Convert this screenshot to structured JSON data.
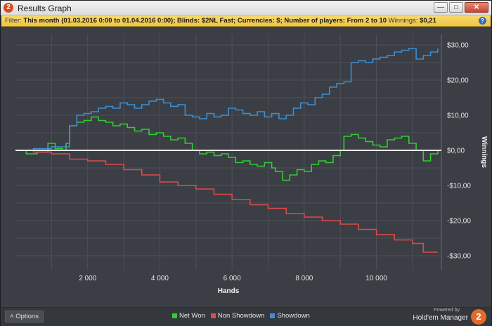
{
  "window": {
    "title": "Results Graph",
    "app_icon_glyph": "2",
    "minimize_glyph": "—",
    "maximize_glyph": "□",
    "close_glyph": "✕"
  },
  "filter": {
    "label": "Filter:",
    "text": "This month (01.03.2016 0:00 to 01.04.2016 0:00); Blinds: $2NL Fast; Currencies: $; Number of players: From 2 to 10",
    "winnings_label": "Winnings:",
    "winnings_value": "$0,21",
    "help_glyph": "?"
  },
  "footer": {
    "options_label": "Options",
    "options_glyph": "˄",
    "powered_by": "Powered by",
    "brand_name": "Hold'em Manager",
    "brand_logo_glyph": "2"
  },
  "colors": {
    "net_won": "#33cc33",
    "non_showdown": "#e04a4a",
    "showdown": "#3b8fd6",
    "zero_line": "#ffffff",
    "grid": "#4d5157",
    "filter_bg": "#f2c94c"
  },
  "chart_data": {
    "type": "line",
    "xlabel": "Hands",
    "ylabel": "Winnings",
    "xlim": [
      0,
      11800
    ],
    "ylim": [
      -34,
      33
    ],
    "x_ticks": [
      2000,
      4000,
      6000,
      8000,
      10000
    ],
    "x_tick_labels": [
      "2 000",
      "4 000",
      "6 000",
      "8 000",
      "10 000"
    ],
    "y_ticks": [
      30,
      20,
      10,
      0,
      -10,
      -20,
      -30
    ],
    "y_tick_labels": [
      "$30,00",
      "$20,00",
      "$10,00",
      "$0,00",
      "-$10,00",
      "-$20,00",
      "-$30,00"
    ],
    "grid": true,
    "legend_position": "bottom-center",
    "series": [
      {
        "name": "Net Won",
        "color": "#33cc33",
        "x": [
          0,
          300,
          600,
          900,
          1100,
          1300,
          1400,
          1500,
          1700,
          1900,
          2100,
          2300,
          2500,
          2700,
          2900,
          3100,
          3300,
          3500,
          3700,
          3900,
          4100,
          4300,
          4500,
          4700,
          4900,
          5100,
          5300,
          5500,
          5700,
          5900,
          6100,
          6300,
          6500,
          6700,
          6900,
          7100,
          7200,
          7400,
          7600,
          7800,
          8000,
          8200,
          8400,
          8600,
          8800,
          9000,
          9100,
          9300,
          9500,
          9700,
          9900,
          10100,
          10300,
          10500,
          10700,
          10900,
          11100,
          11300,
          11500,
          11700
        ],
        "y": [
          0,
          -1,
          -0.5,
          2,
          0.5,
          0,
          2,
          7,
          8,
          8.5,
          9.5,
          8.5,
          8,
          7,
          7.5,
          6.5,
          5.5,
          6,
          4.5,
          5,
          4,
          3,
          3.5,
          2,
          0,
          -1,
          -0.5,
          -1.5,
          -1,
          -2,
          -3.5,
          -3,
          -4,
          -4.5,
          -3.5,
          -5,
          -6,
          -8.5,
          -7,
          -5.5,
          -6,
          -4,
          -3,
          -3.5,
          -1.5,
          0,
          4,
          4.5,
          3.5,
          2.5,
          1.5,
          1,
          3,
          3.5,
          4,
          2,
          0,
          -3,
          -1,
          0
        ]
      },
      {
        "name": "Non Showdown",
        "color": "#e04a4a",
        "x": [
          0,
          500,
          1000,
          1500,
          2000,
          2500,
          3000,
          3500,
          4000,
          4500,
          5000,
          5500,
          6000,
          6500,
          7000,
          7500,
          8000,
          8500,
          9000,
          9500,
          10000,
          10500,
          11000,
          11300,
          11700
        ],
        "y": [
          0,
          -0.5,
          -1,
          -2.5,
          -3,
          -4,
          -5.5,
          -7,
          -9,
          -10,
          -11,
          -12.5,
          -14,
          -15.5,
          -16.5,
          -18,
          -19,
          -20,
          -21,
          -22.5,
          -24,
          -25.5,
          -26.5,
          -29,
          -29
        ]
      },
      {
        "name": "Showdown",
        "color": "#3b8fd6",
        "x": [
          0,
          500,
          1000,
          1300,
          1500,
          1700,
          1900,
          2100,
          2300,
          2500,
          2700,
          2900,
          3100,
          3300,
          3500,
          3700,
          3900,
          4100,
          4300,
          4500,
          4700,
          4900,
          5100,
          5300,
          5500,
          5700,
          5900,
          6100,
          6300,
          6500,
          6700,
          6900,
          7100,
          7300,
          7500,
          7700,
          7900,
          8100,
          8300,
          8500,
          8700,
          8900,
          9100,
          9300,
          9500,
          9700,
          9900,
          10100,
          10300,
          10500,
          10700,
          10900,
          11100,
          11300,
          11500,
          11700
        ],
        "y": [
          0,
          0.5,
          1,
          1,
          7,
          10,
          10.5,
          11,
          12,
          12.5,
          12,
          13.5,
          13,
          12,
          13,
          14,
          14.5,
          13.5,
          12.5,
          13,
          10,
          9.5,
          9,
          10.5,
          9.5,
          10,
          12,
          11.5,
          10.5,
          10,
          11,
          9.5,
          10.5,
          9,
          10,
          12,
          13.5,
          13,
          15,
          16,
          18,
          19,
          19.5,
          25,
          25.5,
          25,
          26,
          26.5,
          27,
          28,
          28.5,
          29,
          26,
          27,
          28,
          29
        ]
      }
    ]
  }
}
